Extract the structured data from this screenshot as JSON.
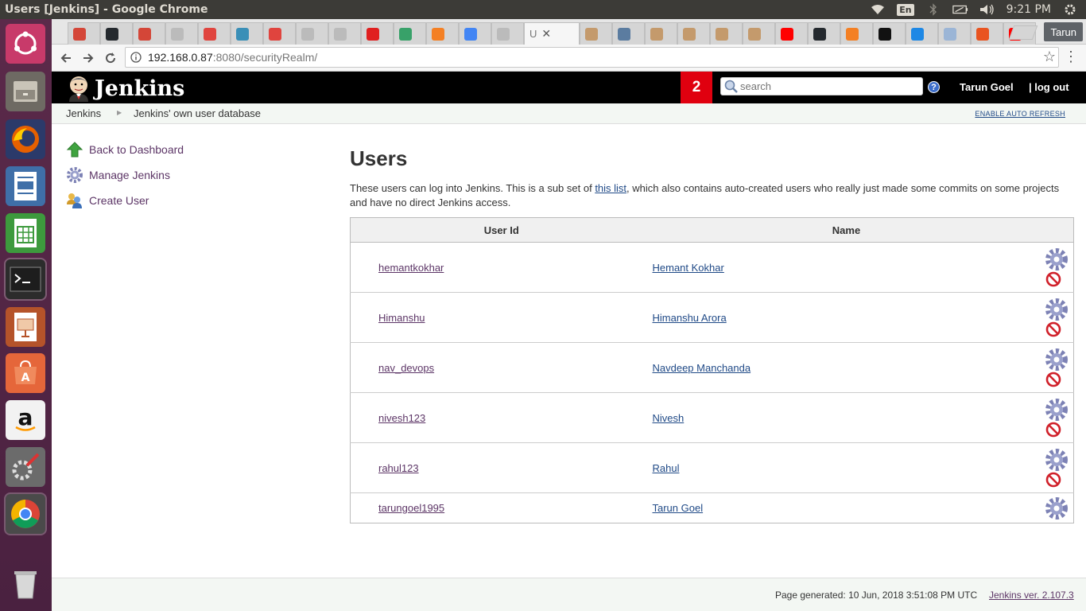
{
  "os": {
    "window_title": "Users [Jenkins] - Google Chrome",
    "tray": {
      "keyboard_layout": "En",
      "clock": "9:21 PM"
    }
  },
  "browser": {
    "profile": "Tarun",
    "url_host": "192.168.0.87",
    "url_rest": ":8080/securityRealm/",
    "active_tab_title": "U"
  },
  "header": {
    "title": "Jenkins",
    "notification_count": "2",
    "search_placeholder": "search",
    "help": "?",
    "user": "Tarun Goel",
    "logout": "| log out"
  },
  "breadcrumbs": {
    "items": [
      "Jenkins",
      "Jenkins' own user database"
    ],
    "auto_refresh": "ENABLE AUTO REFRESH"
  },
  "side_panel": {
    "tasks": [
      "Back to Dashboard",
      "Manage Jenkins",
      "Create User"
    ]
  },
  "main": {
    "title": "Users",
    "desc_before": "These users can log into Jenkins. This is a sub set of ",
    "desc_link": "this list",
    "desc_after": ", which also contains auto-created users who really just made some commits on some projects and have no direct Jenkins access."
  },
  "table": {
    "headers": [
      "User Id",
      "Name"
    ],
    "rows": [
      {
        "id": "hemantkokhar",
        "name": "Hemant Kokhar"
      },
      {
        "id": "Himanshu",
        "name": "Himanshu Arora"
      },
      {
        "id": "nav_devops",
        "name": "Navdeep Manchanda"
      },
      {
        "id": "nivesh123",
        "name": "Nivesh"
      },
      {
        "id": "rahul123",
        "name": "Rahul"
      },
      {
        "id": "tarungoel1995",
        "name": "Tarun Goel"
      }
    ]
  },
  "footer": {
    "generated": "Page generated: 10 Jun, 2018 3:51:08 PM UTC",
    "version": "Jenkins ver. 2.107.3"
  },
  "colors": {
    "jenkins_header": "#000000",
    "notification": "#e0000f",
    "visited_link": "#5c3566",
    "link": "#204a87",
    "launcher": "#5b2a4a"
  }
}
